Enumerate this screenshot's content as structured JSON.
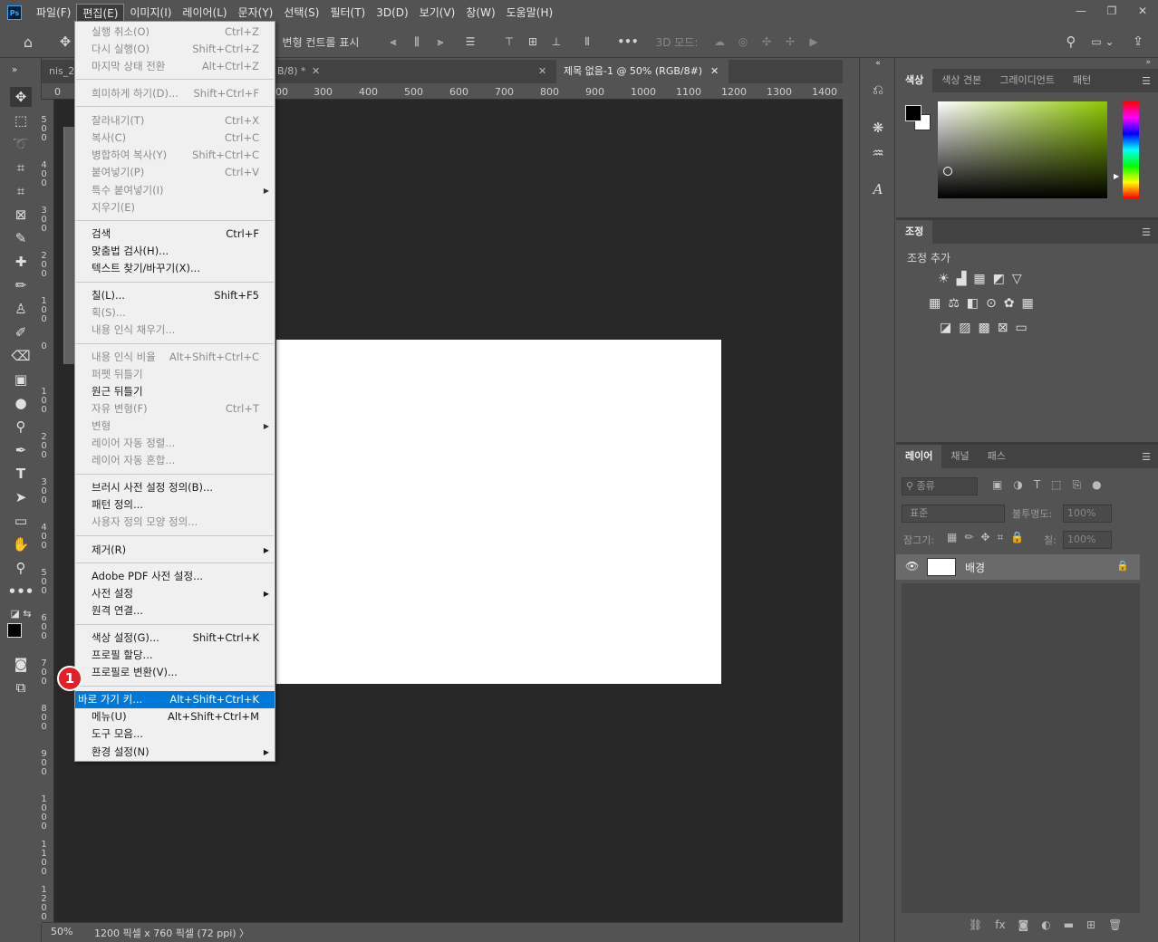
{
  "app": {
    "logo": "Ps"
  },
  "menubar": [
    "파일(F)",
    "편집(E)",
    "이미지(I)",
    "레이어(L)",
    "문자(Y)",
    "선택(S)",
    "필터(T)",
    "3D(D)",
    "보기(V)",
    "창(W)",
    "도움말(H)"
  ],
  "window_controls": [
    "—",
    "❐",
    "✕"
  ],
  "options": {
    "transform_label": "변형 컨트롤 표시",
    "mode3d_label": "3D 모드:"
  },
  "tabs": [
    {
      "label": "nis_2"
    },
    {
      "label": "B/8) *"
    },
    {
      "label": "제목 없음-1 @ 50% (RGB/8#)"
    }
  ],
  "ruler_top": [
    "0",
    "300",
    "400",
    "500",
    "600",
    "700",
    "800",
    "900",
    "1000",
    "1100",
    "1200",
    "1300",
    "1400"
  ],
  "ruler_top_prefix": "00",
  "ruler_left": [
    "5\n0\n0",
    "4\n0\n0",
    "3\n0\n0",
    "2\n0\n0",
    "1\n0\n0",
    "0",
    "1\n0\n0",
    "2\n0\n0",
    "3\n0\n0",
    "4\n0\n0",
    "5\n0\n0",
    "6\n0\n0",
    "7\n0\n0",
    "8\n0\n0",
    "9\n0\n0",
    "1\n0\n0\n0",
    "1\n1\n0\n0",
    "1\n2\n0\n0"
  ],
  "status": {
    "zoom": "50%",
    "info": "1200 픽셀 x 760 픽셀 (72 ppi)",
    "arrow": "〉"
  },
  "edit_menu": {
    "items": [
      {
        "label": "실행 취소(O)",
        "shortcut": "Ctrl+Z",
        "disabled": true
      },
      {
        "label": "다시 실행(O)",
        "shortcut": "Shift+Ctrl+Z",
        "disabled": true
      },
      {
        "label": "마지막 상태 전환",
        "shortcut": "Alt+Ctrl+Z",
        "disabled": true
      },
      {
        "label": "희미하게 하기(D)...",
        "shortcut": "Shift+Ctrl+F",
        "disabled": true
      },
      {
        "label": "잘라내기(T)",
        "shortcut": "Ctrl+X",
        "disabled": true
      },
      {
        "label": "복사(C)",
        "shortcut": "Ctrl+C",
        "disabled": true
      },
      {
        "label": "병합하여 복사(Y)",
        "shortcut": "Shift+Ctrl+C",
        "disabled": true
      },
      {
        "label": "붙여넣기(P)",
        "shortcut": "Ctrl+V",
        "disabled": true
      },
      {
        "label": "특수 붙여넣기(I)",
        "shortcut": "",
        "disabled": true
      },
      {
        "label": "지우기(E)",
        "shortcut": "",
        "disabled": true
      },
      {
        "label": "검색",
        "shortcut": "Ctrl+F",
        "disabled": false
      },
      {
        "label": "맞춤법 검사(H)...",
        "shortcut": "",
        "disabled": false
      },
      {
        "label": "텍스트 찾기/바꾸기(X)...",
        "shortcut": "",
        "disabled": false
      },
      {
        "label": "칠(L)...",
        "shortcut": "Shift+F5",
        "disabled": false
      },
      {
        "label": "획(S)...",
        "shortcut": "",
        "disabled": true
      },
      {
        "label": "내용 인식 채우기...",
        "shortcut": "",
        "disabled": true
      },
      {
        "label": "내용 인식 비율",
        "shortcut": "Alt+Shift+Ctrl+C",
        "disabled": true
      },
      {
        "label": "퍼펫 뒤틀기",
        "shortcut": "",
        "disabled": true
      },
      {
        "label": "원근 뒤틀기",
        "shortcut": "",
        "disabled": false
      },
      {
        "label": "자유 변형(F)",
        "shortcut": "Ctrl+T",
        "disabled": true
      },
      {
        "label": "변형",
        "shortcut": "",
        "disabled": true
      },
      {
        "label": "레이어 자동 정렬...",
        "shortcut": "",
        "disabled": true
      },
      {
        "label": "레이어 자동 혼합...",
        "shortcut": "",
        "disabled": true
      },
      {
        "label": "브러시 사전 설정 정의(B)...",
        "shortcut": "",
        "disabled": false
      },
      {
        "label": "패턴 정의...",
        "shortcut": "",
        "disabled": false
      },
      {
        "label": "사용자 정의 모양 정의...",
        "shortcut": "",
        "disabled": true
      },
      {
        "label": "제거(R)",
        "shortcut": "",
        "disabled": false
      },
      {
        "label": "Adobe PDF 사전 설정...",
        "shortcut": "",
        "disabled": false
      },
      {
        "label": "사전 설정",
        "shortcut": "",
        "disabled": false
      },
      {
        "label": "원격 연결...",
        "shortcut": "",
        "disabled": false
      },
      {
        "label": "색상 설정(G)...",
        "shortcut": "Shift+Ctrl+K",
        "disabled": false
      },
      {
        "label": "프로필 할당...",
        "shortcut": "",
        "disabled": false
      },
      {
        "label": "프로필로 변환(V)...",
        "shortcut": "",
        "disabled": false
      },
      {
        "label": "바로 가기 키...",
        "shortcut": "Alt+Shift+Ctrl+K",
        "disabled": false,
        "highlighted": true
      },
      {
        "label": "메뉴(U)",
        "shortcut": "Alt+Shift+Ctrl+M",
        "disabled": false
      },
      {
        "label": "도구 모음...",
        "shortcut": "",
        "disabled": false
      },
      {
        "label": "환경 설정(N)",
        "shortcut": "",
        "disabled": false
      }
    ]
  },
  "callout": "1",
  "color_panel": {
    "tabs": [
      "색상",
      "색상 견본",
      "그레이디언트",
      "패턴"
    ]
  },
  "adjust_panel": {
    "tab": "조정",
    "add_label": "조정 추가"
  },
  "layers_panel": {
    "tabs": [
      "레이어",
      "채널",
      "패스"
    ],
    "kind_label": "종류",
    "blend_mode": "표준",
    "opacity_label": "불투명도:",
    "opacity_value": "100%",
    "lock_label": "잠그기:",
    "fill_label": "칠:",
    "fill_value": "100%",
    "layer_name": "배경"
  },
  "colors": {
    "accent": "#0078d7",
    "badge": "#e21e26",
    "canvas_bg": "#282828"
  }
}
